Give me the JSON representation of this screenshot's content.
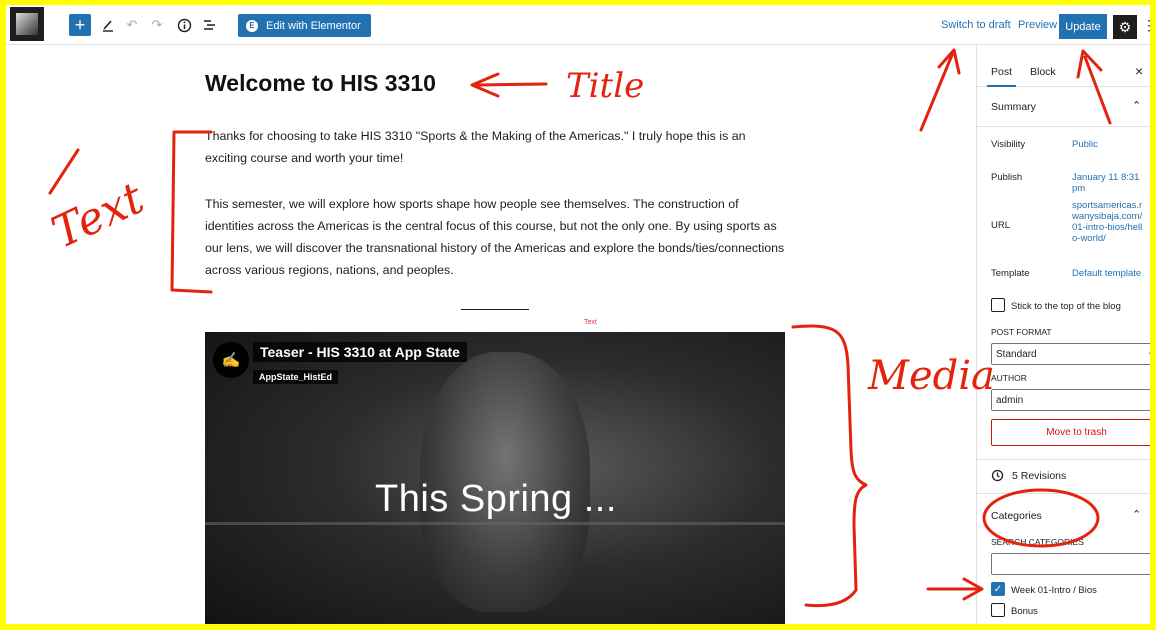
{
  "toolbar": {
    "add_icon": "plus-icon",
    "elementor_label": "Edit with Elementor",
    "switch_to_draft": "Switch to draft",
    "preview": "Preview",
    "update": "Update"
  },
  "post": {
    "title": "Welcome to HIS 3310",
    "paragraph1": "Thanks for choosing to take HIS 3310 \"Sports & the Making of the Americas.\" I truly hope this is an exciting course and worth your time!",
    "paragraph2": "This semester, we will explore how sports shape how people see themselves. The construction of identities across the Americas is the central focus of this course, but not the only one. By using sports as our lens, we will discover the transnational history of the Americas and explore the bonds/ties/connections across various regions, nations, and peoples.",
    "tiny_text": "Text"
  },
  "video": {
    "title": "Teaser - HIS 3310 at App State",
    "channel": "AppState_HistEd",
    "overlay_text": "This Spring ..."
  },
  "sidebar": {
    "tab_post": "Post",
    "tab_block": "Block",
    "summary": {
      "title": "Summary",
      "visibility_label": "Visibility",
      "visibility_value": "Public",
      "publish_label": "Publish",
      "publish_value": "January 11 8:31 pm",
      "url_label": "URL",
      "url_value": "sportsamericas.rwanysibaja.com/01-intro-bios/hello-world/",
      "template_label": "Template",
      "template_value": "Default template",
      "sticky_label": "Stick to the top of the blog",
      "post_format_label": "POST FORMAT",
      "post_format_value": "Standard",
      "author_label": "AUTHOR",
      "author_value": "admin",
      "trash_label": "Move to trash"
    },
    "revisions": "5 Revisions",
    "categories": {
      "title": "Categories",
      "search_label": "SEARCH CATEGORIES",
      "items": [
        {
          "label": "Week 01-Intro / Bios",
          "checked": true
        },
        {
          "label": "Bonus",
          "checked": false
        }
      ]
    }
  },
  "annotations": {
    "title": "Title",
    "text": "Text",
    "media": "Media",
    "color": "#e3230e"
  }
}
